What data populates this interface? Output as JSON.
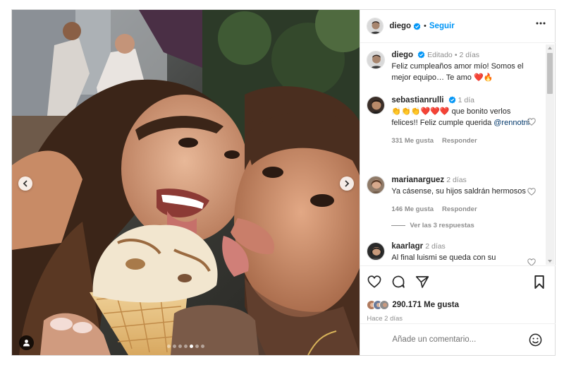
{
  "post": {
    "author": "diego",
    "follow_label": "Seguir",
    "caption": {
      "username": "diego",
      "edited": "Editado",
      "time": "2 días",
      "text": "Feliz cumpleaños amor mío! Somos el mejor equipo… Te amo ❤️🔥"
    },
    "carousel": {
      "slides": 7,
      "active": 4
    }
  },
  "comments": [
    {
      "username": "sebastianrulli",
      "verified": true,
      "time": "1 día",
      "text": "👏👏👏❤️❤️❤️ que bonito verlos felices!! Feliz cumple querida ",
      "mention": "@rennotni",
      "likes": "331 Me gusta",
      "reply": "Responder"
    },
    {
      "username": "marianarguez",
      "time": "2 días",
      "text": "Ya cásense, su hijos saldrán hermosos",
      "likes": "146 Me gusta",
      "reply": "Responder",
      "view_replies": "Ver las 3 respuestas"
    },
    {
      "username": "kaarlagr",
      "time": "2 días",
      "text": "Al final luismi se queda con su"
    }
  ],
  "footer": {
    "likes": "290.171 Me gusta",
    "posted": "Hace 2 días",
    "comment_placeholder": "Añade un comentario..."
  },
  "colors": {
    "accent": "#0095f6",
    "heart": "#ed4956",
    "verified": "#0095f6"
  },
  "icons": [
    "heart-icon",
    "comment-icon",
    "share-icon",
    "bookmark-icon",
    "more-icon",
    "emoji-icon",
    "verified-icon",
    "tag-user-icon",
    "chevron-left-icon",
    "chevron-right-icon"
  ]
}
